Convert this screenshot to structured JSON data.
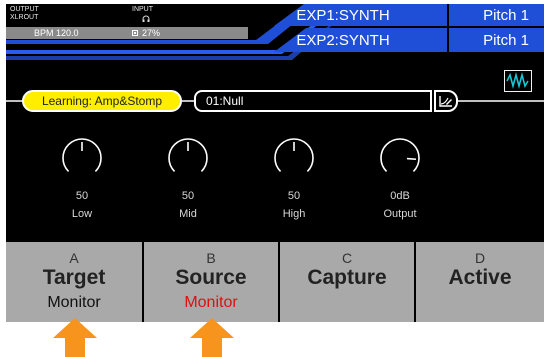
{
  "header": {
    "output_label": "OUTPUT",
    "xlrout_label": "XLROUT",
    "input_label": "INPUT",
    "input_icon": "headphone-icon",
    "bpm": "BPM 120.0",
    "cpu_icon": "cpu-icon",
    "cpu": "27%",
    "exp_rows": [
      {
        "name": "EXP1:SYNTH",
        "value": "Pitch 1"
      },
      {
        "name": "EXP2:SYNTH",
        "value": "Pitch 1"
      }
    ],
    "accent_color": "#1f4fd6"
  },
  "learning": {
    "badge": "Learning: Amp&Stomp",
    "badge_color": "#ffee00",
    "preset": "01:Null",
    "edit_icon": "edit-curve-icon",
    "scope_icon": "oscilloscope-icon"
  },
  "knobs": [
    {
      "value": "50",
      "label": "Low",
      "level": 0.5
    },
    {
      "value": "50",
      "label": "Mid",
      "level": 0.5
    },
    {
      "value": "50",
      "label": "High",
      "level": 0.5
    },
    {
      "value": "0dB",
      "label": "Output",
      "level": 0.85
    }
  ],
  "buttons": [
    {
      "letter": "A",
      "title": "Target",
      "sub": "Monitor",
      "sub_color": "#111111"
    },
    {
      "letter": "B",
      "title": "Source",
      "sub": "Monitor",
      "sub_color": "#e01010"
    },
    {
      "letter": "C",
      "title": "Capture",
      "sub": "",
      "sub_color": "#111111"
    },
    {
      "letter": "D",
      "title": "Active",
      "sub": "",
      "sub_color": "#111111"
    }
  ],
  "arrow_color": "#f7941d"
}
